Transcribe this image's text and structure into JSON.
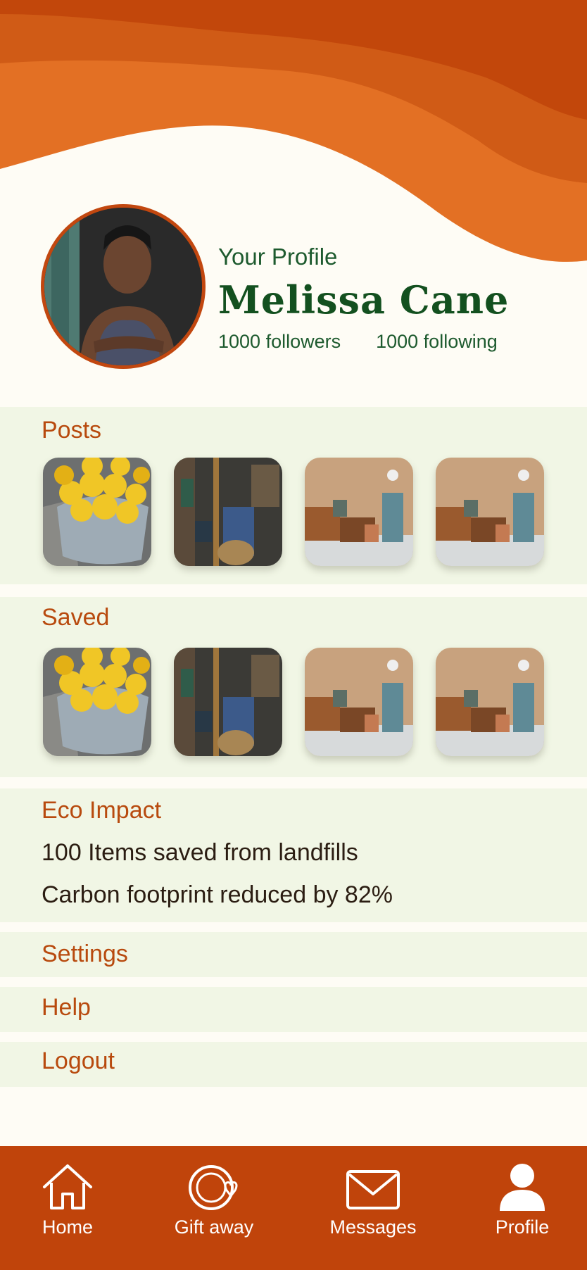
{
  "colors": {
    "orange_dark": "#c0440b",
    "orange": "#e06a1f",
    "green_text": "#13501f",
    "panel_bg": "#f1f6e5",
    "page_bg": "#fefcf5"
  },
  "profile": {
    "heading": "Your Profile",
    "name": "Melissa Cane",
    "followers": "1000 followers",
    "following": "1000 following"
  },
  "posts": {
    "title": "Posts",
    "items": [
      "lemons",
      "shop-shelf",
      "room-items",
      "room-items"
    ]
  },
  "saved": {
    "title": "Saved",
    "items": [
      "lemons",
      "shop-shelf",
      "room-items",
      "room-items"
    ]
  },
  "eco": {
    "title": "Eco Impact",
    "line1": "100 Items saved from landfills",
    "line2": "Carbon footprint reduced by 82%"
  },
  "menu": {
    "settings": "Settings",
    "help": "Help",
    "logout": "Logout"
  },
  "tabbar": {
    "home": {
      "label": "Home",
      "icon": "home-icon"
    },
    "gift": {
      "label": "Gift away",
      "icon": "gift-away-icon"
    },
    "messages": {
      "label": "Messages",
      "icon": "envelope-icon"
    },
    "profile": {
      "label": "Profile",
      "icon": "person-icon"
    }
  }
}
